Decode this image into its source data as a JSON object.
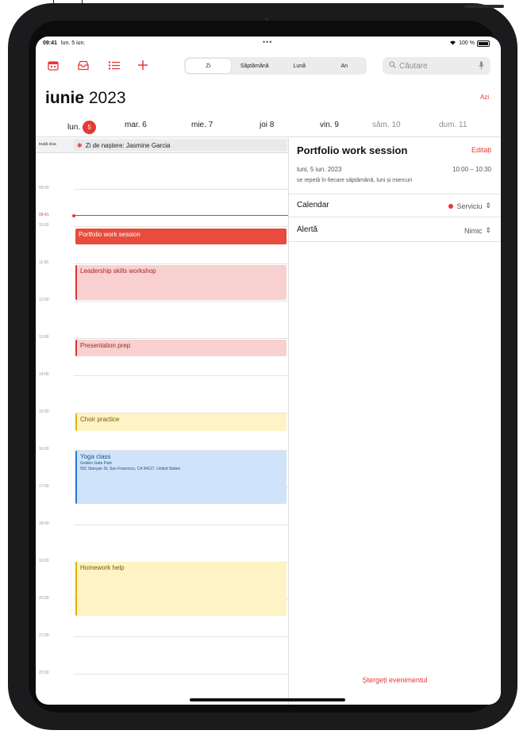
{
  "status_bar": {
    "time": "09:41",
    "date": "lun. 5 iun.",
    "dots": "•••",
    "battery": "100 %"
  },
  "toolbar": {
    "segments": [
      "Zi",
      "Săptămână",
      "Lună",
      "An"
    ],
    "active_segment": "Zi",
    "search_placeholder": "Căutare"
  },
  "header": {
    "month": "iunie",
    "year": "2023",
    "today_label": "Azi"
  },
  "weekdays": [
    {
      "name": "lun.",
      "num": "5",
      "today": true
    },
    {
      "name": "mar.",
      "num": "6"
    },
    {
      "name": "mie.",
      "num": "7"
    },
    {
      "name": "joi",
      "num": "8"
    },
    {
      "name": "vin.",
      "num": "9"
    },
    {
      "name": "sâm.",
      "num": "10",
      "weekend": true
    },
    {
      "name": "dum.",
      "num": "11",
      "weekend": true
    }
  ],
  "all_day": {
    "label": "toată ziua",
    "event": "Zi de naștere: Jasmine Garcia"
  },
  "hours": [
    "09:00",
    "10:00",
    "11:00",
    "12:00",
    "13:00",
    "14:00",
    "15:00",
    "16:00",
    "17:00",
    "18:00",
    "19:00",
    "20:00",
    "21:00",
    "22:00"
  ],
  "now_time": "09:41",
  "events": [
    {
      "title": "Portfolio work session",
      "style": "red"
    },
    {
      "title": "Leadership skills workshop",
      "style": "pink"
    },
    {
      "title": "Presentation prep",
      "style": "pink"
    },
    {
      "title": "Choir practice",
      "style": "yellow"
    },
    {
      "title": "Yoga class",
      "location": "Golden Gate Park",
      "address": "501 Stanyan St, San Francisco, CA 94117, United States",
      "style": "blue"
    },
    {
      "title": "Homework help",
      "style": "yellow"
    }
  ],
  "detail": {
    "title": "Portfolio work session",
    "edit_label": "Editați",
    "date": "luni, 5 iun. 2023",
    "time": "10:00 – 10:30",
    "recurrence": "se repetă în fiecare săptămână, luni și miercuri",
    "calendar_label": "Calendar",
    "calendar_value": "Serviciu",
    "alert_label": "Alertă",
    "alert_value": "Nimic",
    "delete_label": "Ștergeți evenimentul"
  },
  "colors": {
    "accent": "#e53935"
  }
}
